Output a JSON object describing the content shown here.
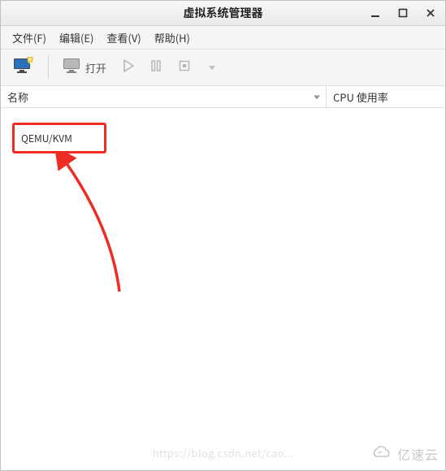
{
  "window": {
    "title": "虚拟系统管理器"
  },
  "menu": {
    "file": "文件(F)",
    "edit": "编辑(E)",
    "view": "查看(V)",
    "help": "帮助(H)"
  },
  "toolbar": {
    "open_label": "打开"
  },
  "columns": {
    "name": "名称",
    "cpu": "CPU 使用率"
  },
  "connections": [
    {
      "label": "QEMU/KVM"
    }
  ],
  "annotation": {
    "highlight_color": "#ef2b24"
  },
  "watermark": {
    "url": "https://blog.csdn.net/cao...",
    "brand": "亿速云"
  }
}
